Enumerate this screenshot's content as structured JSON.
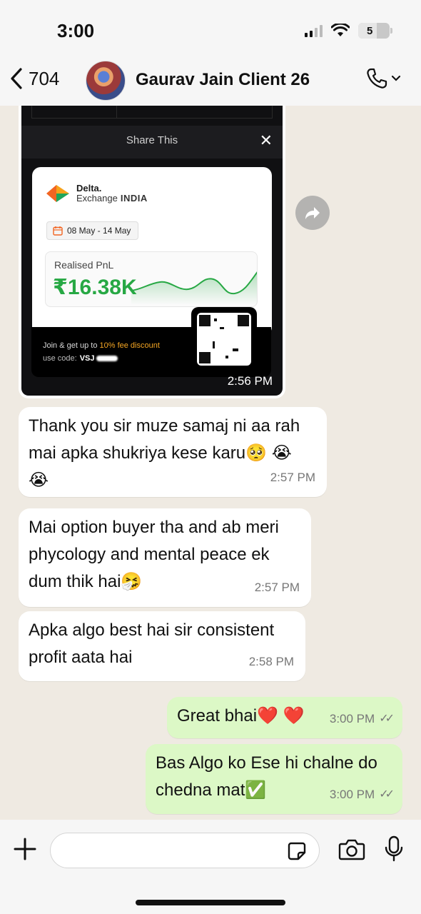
{
  "status_bar": {
    "time": "3:00",
    "battery_level": "5"
  },
  "header": {
    "back_count": "704",
    "contact_name": "Gaurav Jain Client 26"
  },
  "image_message": {
    "share_title": "Share This",
    "brand_line1": "Delta.",
    "brand_line2": "Exchange",
    "brand_region": "INDIA",
    "date_range": "08 May - 14 May",
    "pnl_label": "Realised PnL",
    "pnl_value": "₹16.38K",
    "promo_prefix": "Join & get up to ",
    "promo_highlight": "10% fee discount",
    "code_label": "use code:",
    "code_value": "VSJ",
    "time": "2:56 PM",
    "colors": {
      "profit_green": "#27a844",
      "promo_orange": "#f5a623",
      "logo_orange": "#f26522",
      "logo_green": "#1fa65a"
    }
  },
  "messages": [
    {
      "direction": "in",
      "text": "Thank you sir muze samaj ni aa rah mai apka shukriya kese karu🥺 😭 😭",
      "time": "2:57 PM"
    },
    {
      "direction": "in",
      "text": "Mai option buyer tha and ab meri phycology and mental peace ek dum thik hai🤧",
      "time": "2:57 PM"
    },
    {
      "direction": "in",
      "text": "Apka algo best hai sir consistent profit aata hai",
      "time": "2:58 PM"
    },
    {
      "direction": "out",
      "text": "Great bhai❤️ ❤️",
      "time": "3:00 PM",
      "status": "read"
    },
    {
      "direction": "out",
      "text": "Bas Algo ko Ese hi chalne do chedna mat✅",
      "time": "3:00 PM",
      "status": "read"
    }
  ],
  "input": {
    "placeholder": ""
  },
  "icons": {
    "back": "chevron-left-icon",
    "call": "phone-icon",
    "forward": "forward-icon",
    "attach": "plus-icon",
    "sticker": "sticker-icon",
    "camera": "camera-icon",
    "mic": "mic-icon"
  },
  "colors": {
    "chat_bg": "#efeae2",
    "incoming_bubble": "#ffffff",
    "outgoing_bubble": "#dcf8c6"
  }
}
